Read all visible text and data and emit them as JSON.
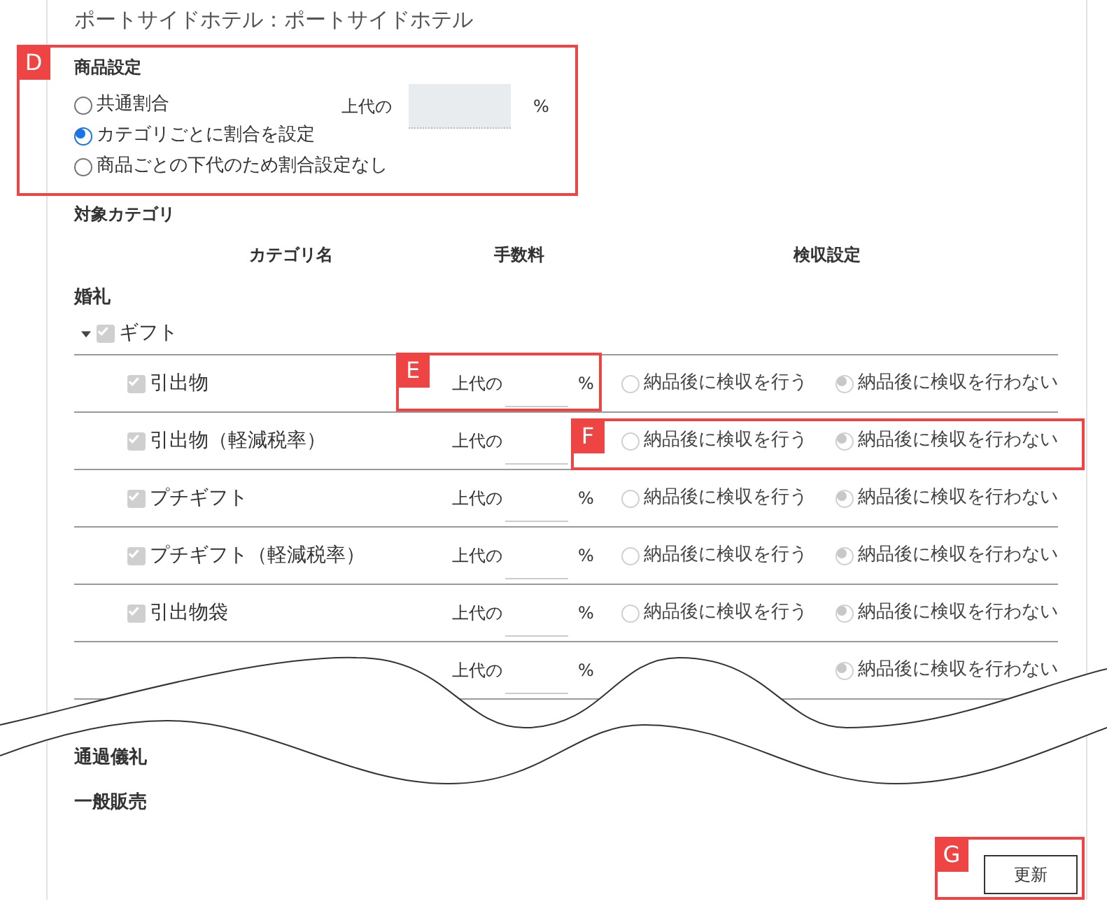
{
  "page_title": "ポートサイドホテル：ポートサイドホテル",
  "product_settings": {
    "heading": "商品設定",
    "options": [
      {
        "label": "共通割合",
        "selected": false
      },
      {
        "label": "カテゴリごとに割合を設定",
        "selected": true
      },
      {
        "label": "商品ごとの下代のため割合設定なし",
        "selected": false
      }
    ],
    "rate": {
      "prefix": "上代の",
      "suffix": "%",
      "disabled": true
    }
  },
  "target_categories": {
    "heading": "対象カテゴリ",
    "columns": [
      "カテゴリ名",
      "手数料",
      "検収設定"
    ],
    "groups": [
      {
        "name": "婚礼",
        "children": [
          {
            "name": "ギフト",
            "checked": true,
            "expanded": true,
            "children": [
              {
                "name": "引出物",
                "checked": true,
                "fee_prefix": "上代の",
                "fee_suffix": "%",
                "inspection_options": [
                  {
                    "label": "納品後に検収を行う",
                    "selected": false
                  },
                  {
                    "label": "納品後に検収を行わない",
                    "selected": true
                  }
                ]
              },
              {
                "name": "引出物（軽減税率）",
                "checked": true,
                "fee_prefix": "上代の",
                "inspection_options": [
                  {
                    "label": "納品後に検収を行う",
                    "selected": false
                  },
                  {
                    "label": "納品後に検収を行わない",
                    "selected": true
                  }
                ]
              },
              {
                "name": "プチギフト",
                "checked": true,
                "fee_prefix": "上代の",
                "fee_suffix": "%",
                "inspection_options": [
                  {
                    "label": "納品後に検収を行う",
                    "selected": false
                  },
                  {
                    "label": "納品後に検収を行わない",
                    "selected": true
                  }
                ]
              },
              {
                "name": "プチギフト（軽減税率）",
                "checked": true,
                "fee_prefix": "上代の",
                "fee_suffix": "%",
                "inspection_options": [
                  {
                    "label": "納品後に検収を行う",
                    "selected": false
                  },
                  {
                    "label": "納品後に検収を行わない",
                    "selected": true
                  }
                ]
              },
              {
                "name": "引出物袋",
                "checked": true,
                "fee_prefix": "上代の",
                "fee_suffix": "%",
                "inspection_options": [
                  {
                    "label": "納品後に検収を行う",
                    "selected": false
                  },
                  {
                    "label": "納品後に検収を行わない",
                    "selected": true
                  }
                ]
              },
              {
                "cut": true,
                "fee_prefix": "上代の",
                "fee_suffix": "%",
                "inspection_options": [
                  {
                    "label": "納品後に検収を行わない",
                    "selected": true
                  }
                ]
              }
            ]
          }
        ]
      },
      {
        "name": "通過儀礼"
      },
      {
        "name": "一般販売"
      }
    ]
  },
  "update_button": "更新",
  "annotations": [
    {
      "label": "D"
    },
    {
      "label": "E"
    },
    {
      "label": "F"
    },
    {
      "label": "G"
    }
  ]
}
